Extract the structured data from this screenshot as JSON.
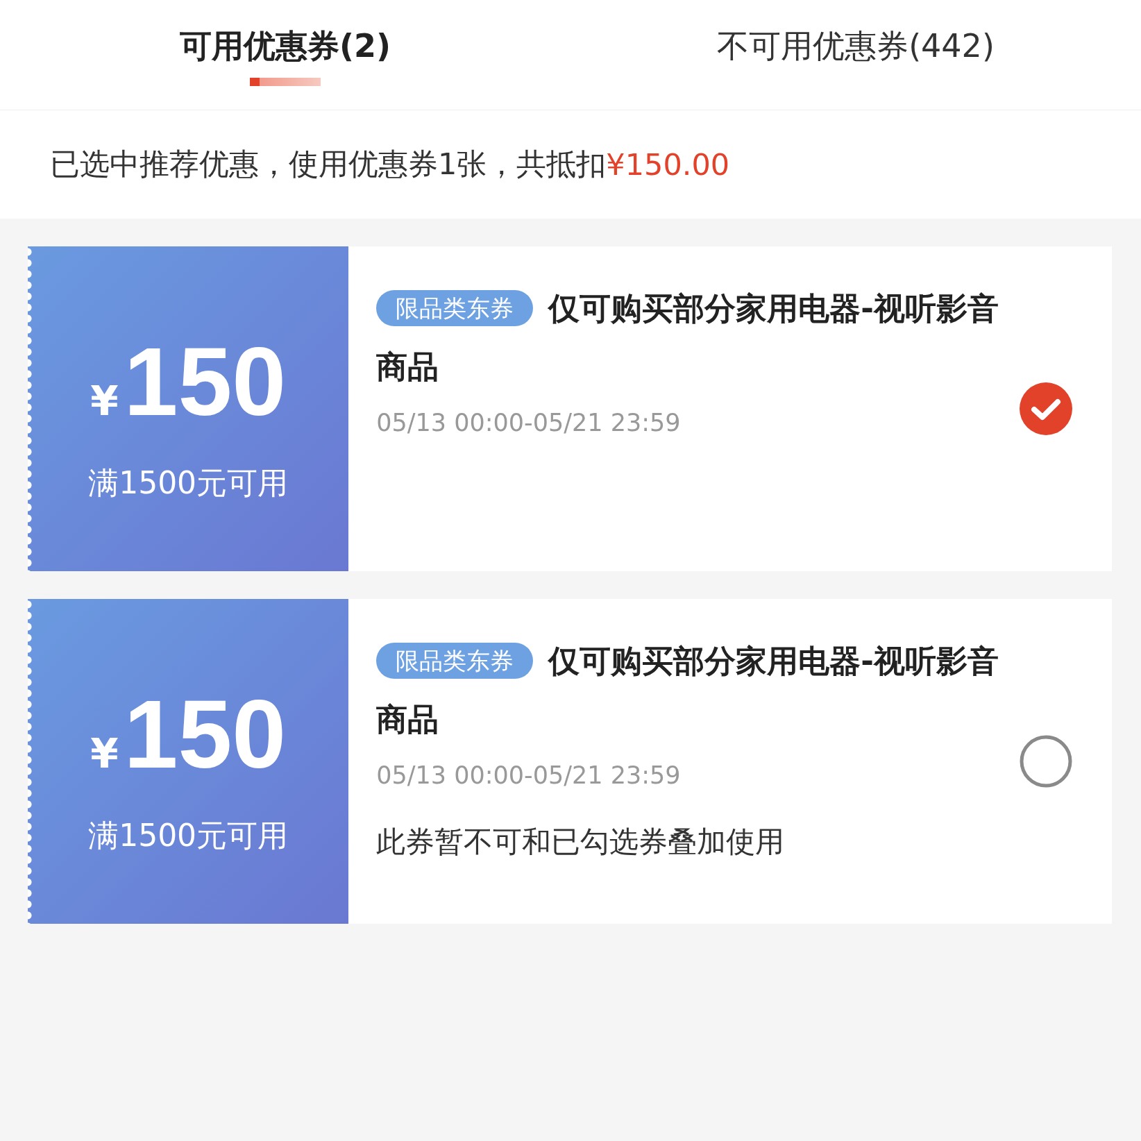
{
  "tabs": [
    {
      "label": "可用优惠券(2)",
      "selected": true
    },
    {
      "label": "不可用优惠券(442)",
      "selected": false
    }
  ],
  "summary": {
    "text": "已选中推荐优惠，使用优惠券1张，共抵扣",
    "amount": "¥150.00"
  },
  "coupons": [
    {
      "currency": "¥",
      "amount": "150",
      "condition": "满1500元可用",
      "badge": "限品类东券",
      "title": "仅可购买部分家用电器-视听影音商品",
      "validity": "05/13 00:00-05/21 23:59",
      "selected": true
    },
    {
      "currency": "¥",
      "amount": "150",
      "condition": "满1500元可用",
      "badge": "限品类东券",
      "title": "仅可购买部分家用电器-视听影音商品",
      "validity": "05/13 00:00-05/21 23:59",
      "note": "此券暂不可和已勾选券叠加使用",
      "selected": false
    }
  ]
}
